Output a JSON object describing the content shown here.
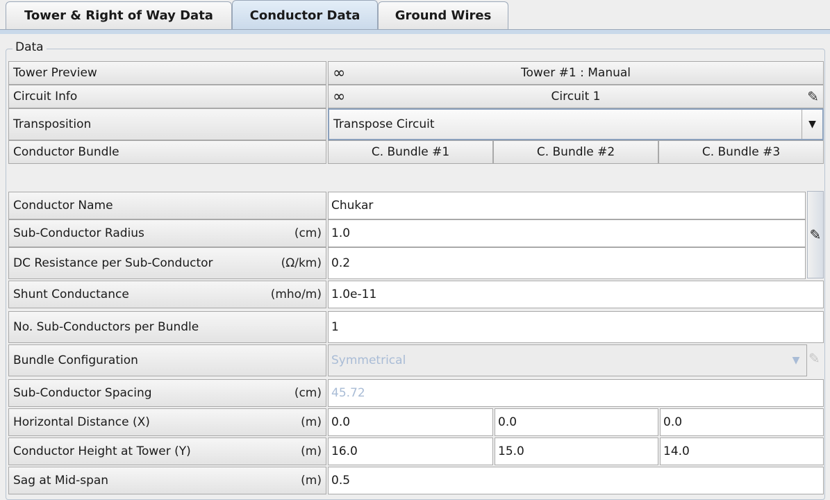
{
  "tabs": [
    {
      "label": "Tower & Right of Way Data",
      "active": false
    },
    {
      "label": "Conductor Data",
      "active": true
    },
    {
      "label": "Ground Wires",
      "active": false
    }
  ],
  "group_title": "Data",
  "rows": {
    "tower_preview": {
      "label": "Tower Preview",
      "value": "Tower #1 : Manual"
    },
    "circuit_info": {
      "label": "Circuit Info",
      "value": "Circuit 1"
    },
    "transposition": {
      "label": "Transposition",
      "value": "Transpose Circuit"
    },
    "conductor_bundle": {
      "label": "Conductor Bundle",
      "values": [
        "C. Bundle #1",
        "C. Bundle #2",
        "C. Bundle #3"
      ]
    },
    "conductor_name": {
      "label": "Conductor Name",
      "value": "Chukar"
    },
    "sub_conductor_radius": {
      "label": "Sub-Conductor Radius",
      "unit": "(cm)",
      "value": "1.0"
    },
    "dc_resistance": {
      "label": "DC Resistance per Sub-Conductor",
      "unit": "(Ω/km)",
      "value": "0.2"
    },
    "shunt_conductance": {
      "label": "Shunt Conductance",
      "unit": "(mho/m)",
      "value": "1.0e-11"
    },
    "num_sub_conductors": {
      "label": "No. Sub-Conductors per Bundle",
      "value": "1"
    },
    "bundle_configuration": {
      "label": "Bundle Configuration",
      "value": "Symmetrical"
    },
    "sub_conductor_spacing": {
      "label": "Sub-Conductor Spacing",
      "unit": "(cm)",
      "value": "45.72"
    },
    "horizontal_distance": {
      "label": "Horizontal Distance (X)",
      "unit": "(m)",
      "values": [
        "0.0",
        "0.0",
        "0.0"
      ]
    },
    "conductor_height": {
      "label": "Conductor Height at Tower (Y)",
      "unit": "(m)",
      "values": [
        "16.0",
        "15.0",
        "14.0"
      ]
    },
    "sag_mid_span": {
      "label": "Sag at Mid-span",
      "unit": "(m)",
      "value": "0.5"
    }
  },
  "icons": {
    "preview": "glasses-icon",
    "edit": "pencil-icon",
    "dropdown": "chevron-down-icon"
  }
}
